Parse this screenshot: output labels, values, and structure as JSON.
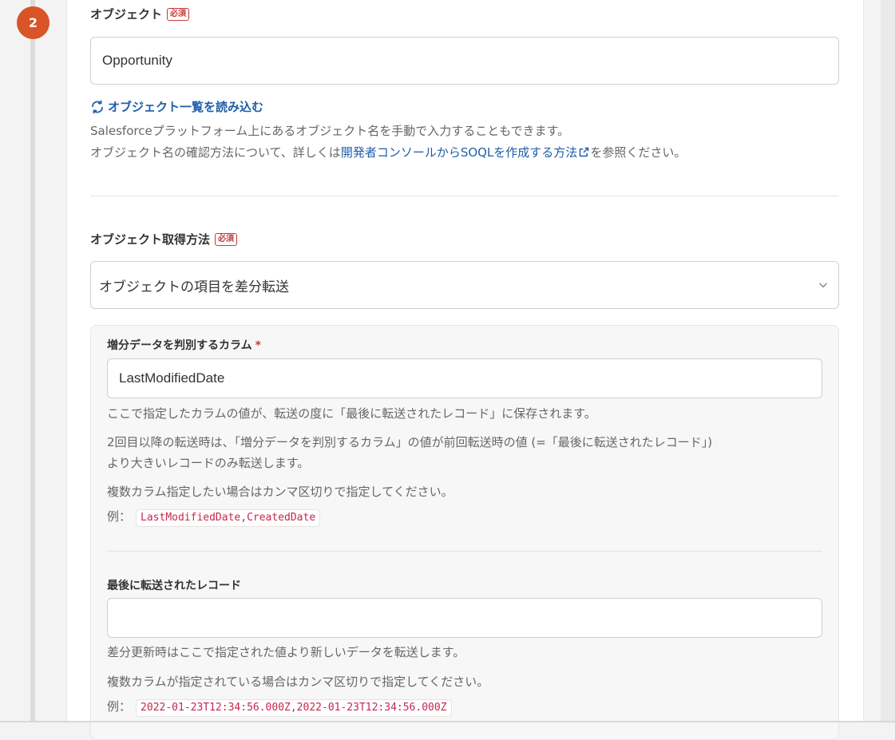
{
  "step": {
    "number": "2"
  },
  "object": {
    "label": "オブジェクト",
    "required_badge": "必須",
    "value": "Opportunity",
    "load_link": "オブジェクト一覧を読み込む",
    "help_line1": "Salesforceプラットフォーム上にあるオブジェクト名を手動で入力することもできます。",
    "help_line2_pre": "オブジェクト名の確認方法について、詳しくは",
    "help_line2_link": "開発者コンソールからSOQLを作成する方法",
    "help_line2_post": "を参照ください。"
  },
  "method": {
    "label": "オブジェクト取得方法",
    "required_badge": "必須",
    "selected": "オブジェクトの項目を差分転送"
  },
  "incremental_column": {
    "label": "増分データを判別するカラム",
    "required_mark": "*",
    "value": "LastModifiedDate",
    "help1": "ここで指定したカラムの値が、転送の度に「最後に転送されたレコード」に保存されます。",
    "help2_line1": "2回目以降の転送時は、「増分データを判別するカラム」の値が前回転送時の値 (=「最後に転送されたレコード」)",
    "help2_line2": "より大きいレコードのみ転送します。",
    "help3": "複数カラム指定したい場合はカンマ区切りで指定してください。",
    "example_label": "例：",
    "example_code": "LastModifiedDate,CreatedDate"
  },
  "last_record": {
    "label": "最後に転送されたレコード",
    "value": "",
    "help1": "差分更新時はここで指定された値より新しいデータを転送します。",
    "help2": "複数カラムが指定されている場合はカンマ区切りで指定してください。",
    "example_label": "例：",
    "example_code": "2022-01-23T12:34:56.000Z,2022-01-23T12:34:56.000Z"
  },
  "colors": {
    "accent": "#d95427",
    "link": "#1f5ea8",
    "required": "#c63b3b"
  }
}
